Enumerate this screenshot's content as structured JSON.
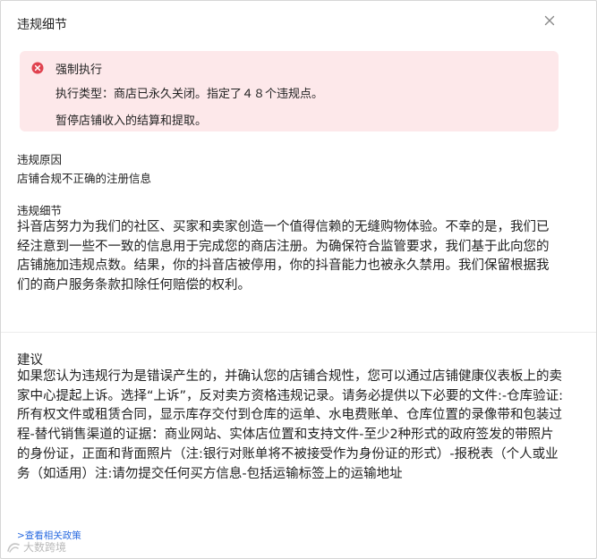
{
  "dialog": {
    "title": "违规细节",
    "close_icon": "close-icon"
  },
  "alert": {
    "icon": "error-circle-icon",
    "color": "#e0424f",
    "background": "#fde8ea",
    "title": "强制执行",
    "line1": "执行类型：商店已永久关闭。指定了４８个违规点。",
    "line2": "暂停店铺收入的结算和提取。"
  },
  "reason": {
    "label": "违规原因",
    "value": "店铺合规不正确的注册信息"
  },
  "detail": {
    "label": "违规细节",
    "text": "抖音店努力为我们的社区、买家和卖家创造一个值得信赖的无缝购物体验。不幸的是，我们已经注意到一些不一致的信息用于完成您的商店注册。为确保符合监管要求，我们基于此向您的店铺施加违规点数。结果，你的抖音店被停用，你的抖音能力也被永久禁用。我们保留根据我们的商户服务条款扣除任何赔偿的权利。"
  },
  "suggestion": {
    "label": "建议",
    "text": "如果您认为违规行为是错误产生的，并确认您的店铺合规性，您可以通过店铺健康仪表板上的卖家中心提起上诉。选择“上诉”，反对卖方资格违规记录。请务必提供以下必要的文件:-仓库验证:所有权文件或租赁合同，显示库存交付到仓库的运单、水电费账单、仓库位置的录像带和包装过程-替代销售渠道的证据：商业网站、实体店位置和支持文件-至少2种形式的政府签发的带照片的身份证，正面和背面照片（注:银行对账单将不被接受作为身份证的形式）-报税表（个人或业务（如适用）注:请勿提交任何买方信息-包括运输标签上的运输地址"
  },
  "footer": {
    "link_label": ">查看相关政策",
    "link_color": "#2a6be0",
    "watermark": "大数跨境"
  }
}
